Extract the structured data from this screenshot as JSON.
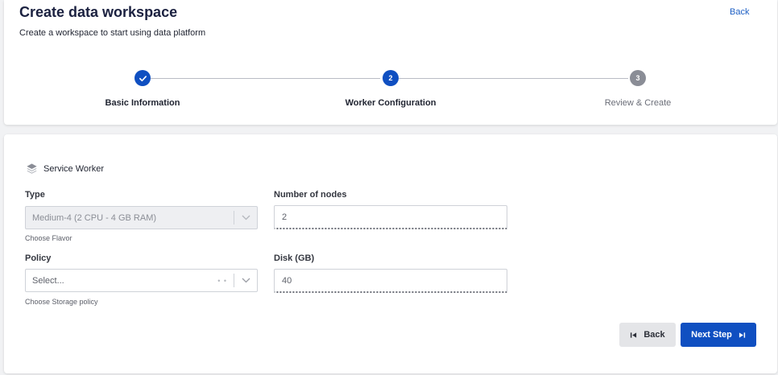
{
  "header": {
    "title": "Create data workspace",
    "subtitle": "Create a workspace to start using data platform",
    "back_link": "Back"
  },
  "stepper": {
    "steps": [
      {
        "number": "1",
        "label": "Basic Information",
        "state": "completed"
      },
      {
        "number": "2",
        "label": "Worker Configuration",
        "state": "active"
      },
      {
        "number": "3",
        "label": "Review & Create",
        "state": "pending"
      }
    ]
  },
  "section": {
    "title": "Service Worker",
    "icon": "layers-icon"
  },
  "form": {
    "type": {
      "label": "Type",
      "value": "Medium-4 (2 CPU - 4 GB RAM)",
      "help": "Choose Flavor",
      "disabled": true
    },
    "nodes": {
      "label": "Number of nodes",
      "value": "2"
    },
    "policy": {
      "label": "Policy",
      "placeholder": "Select...",
      "help": "Choose Storage policy",
      "loading_indicator": "• •"
    },
    "disk": {
      "label": "Disk (GB)",
      "value": "40"
    }
  },
  "actions": {
    "back_label": "Back",
    "next_label": "Next Step"
  },
  "colors": {
    "primary": "#0f4fc1",
    "pending_step": "#8a8d96",
    "link": "#1d5fc4"
  }
}
